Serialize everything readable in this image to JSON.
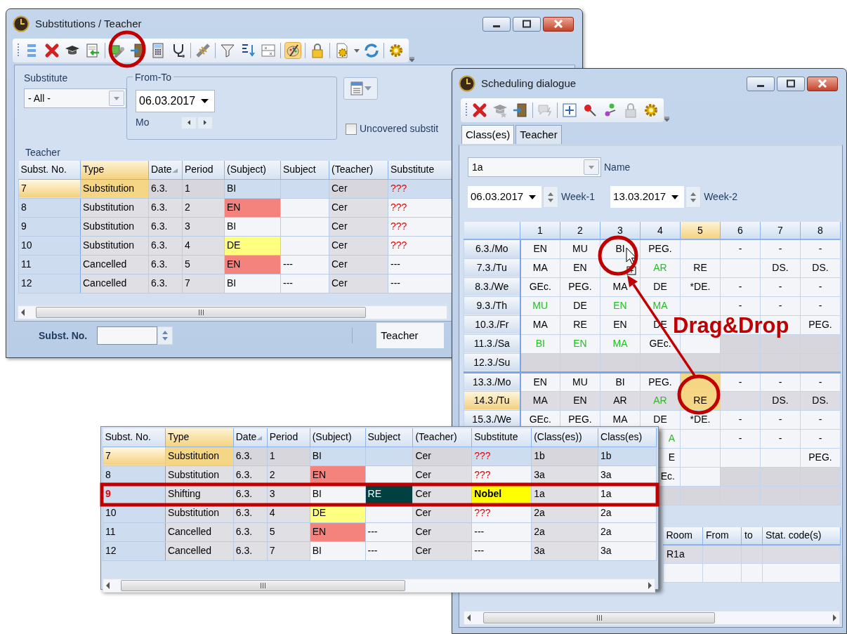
{
  "window_substitutions": {
    "title": "Substitutions / Teacher",
    "toolbar": [
      {
        "pressed": false
      },
      {
        "pressed": false
      },
      {
        "pressed": false
      },
      {
        "pressed": false
      },
      {
        "pressed": false
      },
      {
        "pressed": false
      },
      {
        "pressed": false
      },
      {
        "pressed": false
      },
      {
        "pressed": false
      },
      {
        "pressed": false
      },
      {
        "pressed": false
      },
      {
        "pressed": false
      },
      {
        "pressed": true
      },
      {
        "pressed": false
      },
      {
        "pressed": false
      },
      {
        "pressed": false
      },
      {
        "pressed": false
      }
    ],
    "filter": {
      "substitute_label": "Substitute",
      "substitute_value": "- All -",
      "range_label": "From-To",
      "date": "06.03.2017",
      "weekday": "Mo",
      "uncovered_label": "Uncovered substit",
      "uncovered_checked": false,
      "teacher_label": "Teacher"
    },
    "table": {
      "columns": [
        {
          "label": "Subst. No.",
          "selected": false,
          "sorted": false
        },
        {
          "label": "Type",
          "selected": true,
          "sorted": false
        },
        {
          "label": "Date",
          "selected": false,
          "sorted": true
        },
        {
          "label": "Period",
          "selected": false,
          "sorted": false
        },
        {
          "label": "(Subject)",
          "selected": false,
          "sorted": false
        },
        {
          "label": "Subject",
          "selected": false,
          "sorted": false
        },
        {
          "label": "(Teacher)",
          "selected": false,
          "sorted": false
        },
        {
          "label": "Substitute",
          "selected": false,
          "sorted": false
        }
      ],
      "rows": [
        {
          "selected": true,
          "cells": [
            "7",
            "Substitution",
            "6.3.",
            "1",
            "BI",
            null,
            "Cer",
            {
              "text": "???",
              "kind": "missing"
            }
          ]
        },
        {
          "selected": false,
          "cells": [
            "8",
            "Substitution",
            "6.3.",
            "2",
            {
              "text": "EN",
              "color": "#f4837d"
            },
            null,
            "Cer",
            {
              "text": "???",
              "kind": "missing"
            }
          ]
        },
        {
          "selected": false,
          "cells": [
            "9",
            "Substitution",
            "6.3.",
            "3",
            "BI",
            null,
            "Cer",
            {
              "text": "???",
              "kind": "missing"
            }
          ]
        },
        {
          "selected": false,
          "cells": [
            "10",
            "Substitution",
            "6.3.",
            "4",
            {
              "text": "DE",
              "color": "#ffff80"
            },
            null,
            "Cer",
            {
              "text": "???",
              "kind": "missing"
            }
          ]
        },
        {
          "selected": false,
          "cells": [
            "11",
            "Cancelled",
            "6.3.",
            "5",
            {
              "text": "EN",
              "color": "#f4837d"
            },
            "---",
            "Cer",
            "---"
          ]
        },
        {
          "selected": false,
          "cells": [
            "12",
            "Cancelled",
            "6.3.",
            "7",
            "BI",
            "---",
            "Cer",
            "---"
          ]
        }
      ]
    },
    "footer": {
      "number_label": "Subst. No.",
      "view_label": "Teacher"
    }
  },
  "window_scheduling": {
    "title": "Scheduling dialogue",
    "toolbar": [
      {
        "disabled": false
      },
      {
        "disabled": true
      },
      {
        "disabled": false
      },
      {
        "disabled": true
      },
      {
        "disabled": false
      },
      {
        "disabled": false
      },
      {
        "disabled": false
      },
      {
        "disabled": true
      },
      {
        "disabled": false
      }
    ],
    "tabs": [
      {
        "label": "Class(es)",
        "selected": true
      },
      {
        "label": "Teacher",
        "selected": false
      }
    ],
    "class_value": "1a",
    "class_label": "Name",
    "week_fields": [
      {
        "date": "06.03.2017",
        "label": "Week-1"
      },
      {
        "date": "13.03.2017",
        "label": "Week-2"
      }
    ],
    "grid": {
      "periods": [
        {
          "label": "1",
          "selected": false
        },
        {
          "label": "2",
          "selected": false
        },
        {
          "label": "3",
          "selected": false
        },
        {
          "label": "4",
          "selected": false
        },
        {
          "label": "5",
          "selected": true
        },
        {
          "label": "6",
          "selected": false
        },
        {
          "label": "7",
          "selected": false
        },
        {
          "label": "8",
          "selected": false
        }
      ],
      "weeks": [
        {
          "rows": [
            {
              "label": "6.3./Mo",
              "selected": false,
              "cells": [
                "EN",
                "MU",
                "BI",
                "PEG.",
                null,
                "-",
                "-",
                "-"
              ]
            },
            {
              "label": "7.3./Tu",
              "selected": false,
              "cells": [
                "MA",
                "EN",
                null,
                {
                  "text": "AR",
                  "color": "#22c022"
                },
                "RE",
                null,
                "DS.",
                "DS."
              ]
            },
            {
              "label": "8.3./We",
              "selected": false,
              "cells": [
                "GEc.",
                "PEG.",
                "MA",
                "DE",
                "*DE.",
                "-",
                "-",
                "-"
              ]
            },
            {
              "label": "9.3./Th",
              "selected": false,
              "cells": [
                {
                  "text": "MU",
                  "color": "#22c022"
                },
                "DE",
                {
                  "text": "EN",
                  "color": "#22c022"
                },
                {
                  "text": "MA",
                  "color": "#22c022"
                },
                null,
                "-",
                "-",
                "-"
              ]
            },
            {
              "label": "10.3./Fr",
              "selected": false,
              "cells": [
                "MA",
                "RE",
                "EN",
                "DE",
                null,
                null,
                null,
                "PEG."
              ]
            },
            {
              "label": "11.3./Sa",
              "selected": false,
              "cells": [
                {
                  "text": "BI",
                  "color": "#22c022"
                },
                {
                  "text": "EN",
                  "color": "#22c022"
                },
                {
                  "text": "MA",
                  "color": "#22c022"
                },
                "GEc.",
                null,
                {
                  "blocked": true
                },
                {
                  "blocked": true
                },
                {
                  "blocked": true
                }
              ]
            },
            {
              "label": "12.3./Su",
              "selected": false,
              "cells": [
                {
                  "blocked": true
                },
                {
                  "blocked": true
                },
                {
                  "blocked": true
                },
                {
                  "blocked": true
                },
                {
                  "blocked": true
                },
                {
                  "blocked": true
                },
                {
                  "blocked": true
                },
                {
                  "blocked": true
                }
              ]
            }
          ]
        },
        {
          "rows": [
            {
              "label": "13.3./Mo",
              "selected": false,
              "cells": [
                "EN",
                "MU",
                "BI",
                "PEG.",
                {
                  "selected": true
                },
                "-",
                "-",
                "-"
              ]
            },
            {
              "label": "14.3./Tu",
              "selected": true,
              "cells": [
                "MA",
                "EN",
                "AR",
                {
                  "text": "AR",
                  "color": "#22c022"
                },
                {
                  "text": "RE",
                  "selected": true
                },
                null,
                "DS.",
                "DS."
              ]
            },
            {
              "label": "15.3./We",
              "selected": false,
              "cells": [
                "GEc.",
                "PEG.",
                "MA",
                "DE",
                "*DE.",
                "-",
                "-",
                "-"
              ]
            },
            {
              "selected": false,
              "cells": [
                "",
                "",
                "",
                {
                  "text": "A",
                  "color": "#22c022"
                },
                null,
                "-",
                "-",
                "-"
              ]
            },
            {
              "selected": false,
              "cells": [
                "",
                "",
                "",
                "E",
                null,
                null,
                null,
                "PEG."
              ]
            },
            {
              "selected": false,
              "cells": [
                "",
                "",
                "",
                "Ec.",
                null,
                {
                  "blocked": true
                },
                {
                  "blocked": true
                },
                {
                  "blocked": true
                }
              ]
            },
            {
              "selected": false,
              "cells": [
                "",
                "",
                "",
                {
                  "blocked": true
                },
                {
                  "blocked": true
                },
                {
                  "blocked": true
                },
                {
                  "blocked": true
                },
                {
                  "blocked": true
                }
              ]
            }
          ]
        }
      ]
    },
    "lessons": {
      "columns": [
        "Room",
        "From",
        "to",
        "Stat. code(s)"
      ],
      "rows": [
        [
          "R1a"
        ]
      ]
    }
  },
  "shifted_list": {
    "columns": [
      {
        "label": "Subst. No.",
        "selected": false,
        "sorted": false
      },
      {
        "label": "Type",
        "selected": true,
        "sorted": false
      },
      {
        "label": "Date",
        "selected": false,
        "sorted": true
      },
      {
        "label": "Period",
        "selected": false,
        "sorted": false
      },
      {
        "label": "(Subject)",
        "selected": false,
        "sorted": false
      },
      {
        "label": "Subject",
        "selected": false,
        "sorted": false
      },
      {
        "label": "(Teacher)",
        "selected": false,
        "sorted": false
      },
      {
        "label": "Substitute",
        "selected": false,
        "sorted": false
      },
      {
        "label": "(Class(es))",
        "selected": false,
        "sorted": false
      },
      {
        "label": "Class(es)",
        "selected": false,
        "sorted": false
      }
    ],
    "rows": [
      {
        "selected": true,
        "cells": [
          "7",
          "Substitution",
          "6.3.",
          "1",
          "BI",
          null,
          "Cer",
          {
            "text": "???",
            "kind": "missing"
          },
          "1b",
          "1b"
        ]
      },
      {
        "selected": false,
        "cells": [
          "8",
          "Substitution",
          "6.3.",
          "2",
          {
            "text": "EN",
            "color": "#f4837d"
          },
          null,
          "Cer",
          {
            "text": "???",
            "kind": "missing"
          },
          "3a",
          "3a"
        ]
      },
      {
        "selected": false,
        "cells": [
          {
            "text": "9",
            "kind": "flagged"
          },
          "Shifting",
          "6.3.",
          "3",
          "BI",
          {
            "text": "RE",
            "color": "#004040"
          },
          "Cer",
          {
            "text": "Nobel",
            "color": "#ffff00",
            "kind": "bold"
          },
          "1a",
          "1a"
        ]
      },
      {
        "selected": false,
        "cells": [
          "10",
          "Substitution",
          "6.3.",
          "4",
          {
            "text": "DE",
            "color": "#ffff80"
          },
          null,
          "Cer",
          {
            "text": "???",
            "kind": "missing"
          },
          "2a",
          "2a"
        ]
      },
      {
        "selected": false,
        "cells": [
          "11",
          "Cancelled",
          "6.3.",
          "5",
          {
            "text": "EN",
            "color": "#f4837d"
          },
          "---",
          "Cer",
          "---",
          "2a",
          "2a"
        ]
      },
      {
        "selected": false,
        "cells": [
          "12",
          "Cancelled",
          "6.3.",
          "7",
          "BI",
          "---",
          "Cer",
          "---",
          "3a",
          "3a"
        ]
      }
    ]
  },
  "annotation": {
    "label": "Drag&Drop"
  }
}
